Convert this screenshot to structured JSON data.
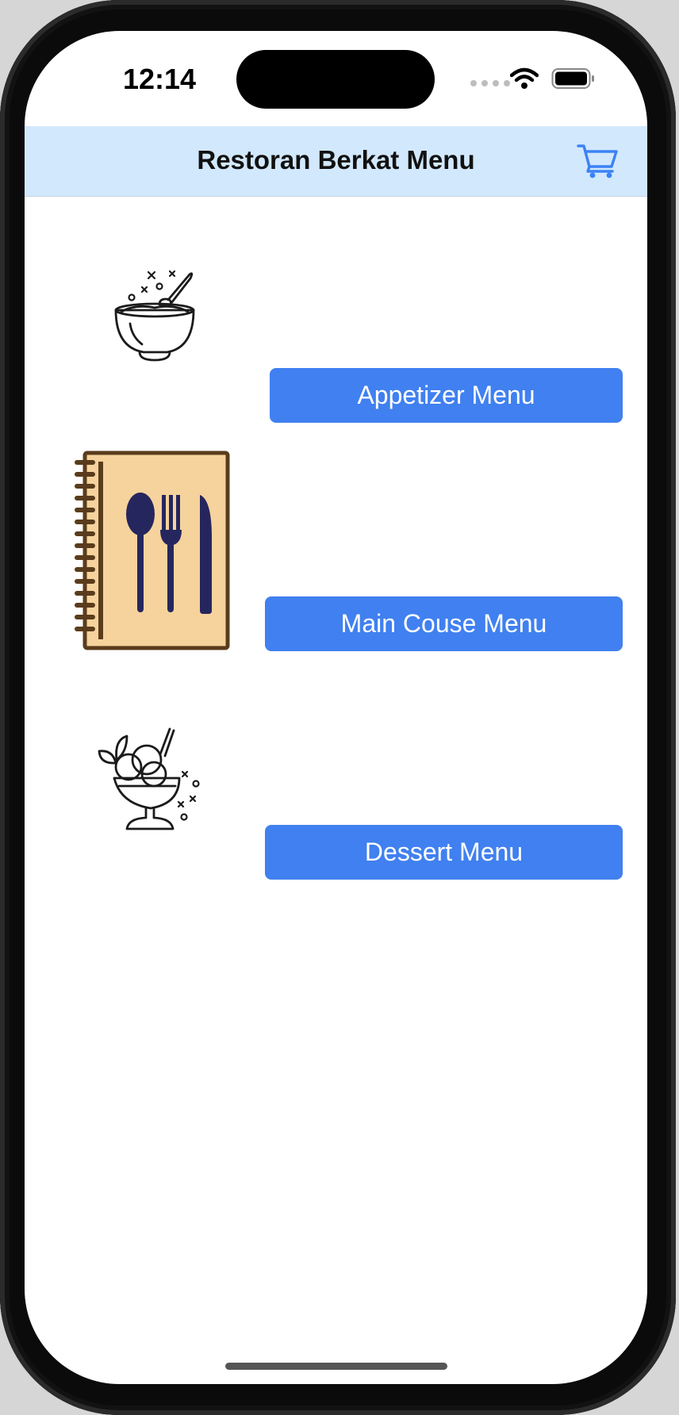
{
  "status_bar": {
    "time": "12:14"
  },
  "nav": {
    "title": "Restoran Berkat Menu",
    "cart_icon": "cart-icon"
  },
  "menus": [
    {
      "label": "Appetizer Menu",
      "icon": "soup-bowl-icon"
    },
    {
      "label": "Main Couse Menu",
      "icon": "menu-book-icon"
    },
    {
      "label": "Dessert Menu",
      "icon": "ice-cream-sundae-icon"
    }
  ],
  "colors": {
    "nav_background": "#d2e8fc",
    "button": "#4080f0",
    "menu_book_cover": "#f6d39c",
    "menu_book_border": "#5a3c1c",
    "cutlery": "#26265e"
  }
}
